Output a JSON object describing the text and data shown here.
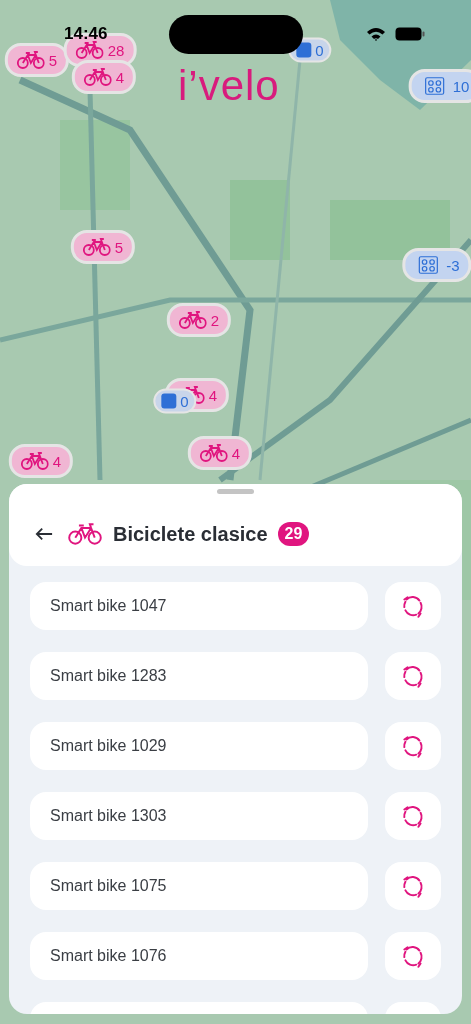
{
  "status_bar": {
    "time": "14:46"
  },
  "logo": "i’velo",
  "map": {
    "markers": [
      {
        "kind": "bike",
        "count": "5"
      },
      {
        "kind": "bike",
        "count": "28"
      },
      {
        "kind": "bike",
        "count": "4"
      },
      {
        "kind": "parking",
        "count": "0"
      },
      {
        "kind": "dock",
        "count": "10"
      },
      {
        "kind": "bike",
        "count": "5"
      },
      {
        "kind": "dock",
        "count": "-3"
      },
      {
        "kind": "bike",
        "count": "2"
      },
      {
        "kind": "bike",
        "count": "4"
      },
      {
        "kind": "parking",
        "count": "0"
      },
      {
        "kind": "bike",
        "count": "4"
      },
      {
        "kind": "bike",
        "count": "4"
      }
    ]
  },
  "sheet": {
    "title": "Biciclete clasice",
    "count": "29",
    "bikes": [
      {
        "name": "Smart bike 1047"
      },
      {
        "name": "Smart bike 1283"
      },
      {
        "name": "Smart bike 1029"
      },
      {
        "name": "Smart bike 1303"
      },
      {
        "name": "Smart bike 1075"
      },
      {
        "name": "Smart bike 1076"
      }
    ]
  }
}
